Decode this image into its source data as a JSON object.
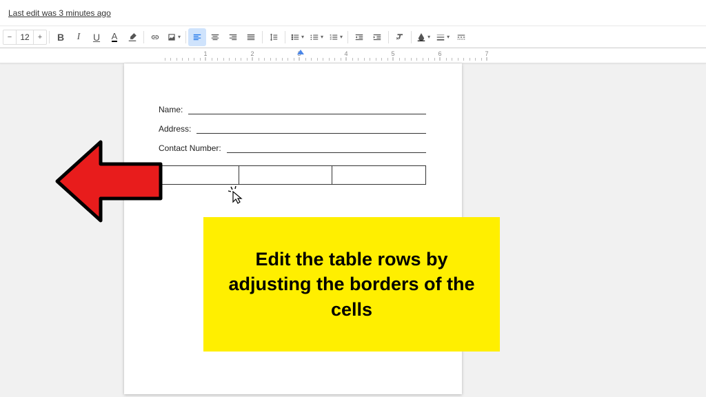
{
  "header": {
    "last_edit": "Last edit was 3 minutes ago"
  },
  "toolbar": {
    "font_size": "12",
    "bold": "B",
    "italic": "I",
    "underline": "U",
    "text_color": "A"
  },
  "ruler": {
    "ticks": [
      "1",
      "2",
      "3",
      "4",
      "5",
      "6",
      "7"
    ],
    "indent_at": 256
  },
  "form": {
    "name_label": "Name:",
    "address_label": "Address:",
    "contact_label": "Contact Number:"
  },
  "callout": {
    "text": "Edit the table rows by adjusting the borders of the cells"
  }
}
